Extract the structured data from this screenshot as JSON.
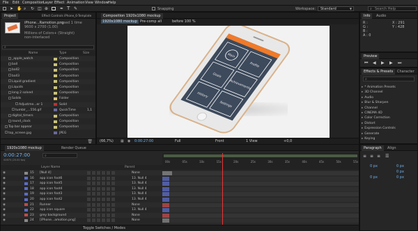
{
  "app": {
    "menu": [
      "File",
      "Edit",
      "Composition",
      "Layer",
      "Effect",
      "Animation",
      "View",
      "Window",
      "Help"
    ],
    "snapping_label": "Snapping",
    "workspace_label": "Workspace:",
    "workspace_value": "Standard",
    "search_placeholder": "Search Help"
  },
  "project": {
    "tab_label": "Project",
    "effect_controls_label": "Effect Controls iPhone_6-Template",
    "file_name": "iPhone...Ramotion.png",
    "file_used": ", used 1 time",
    "file_dims": "9600 x 2700 (1.00)",
    "file_color": "Millions of Colors+ (Straight)",
    "file_interlace": "non-interlaced",
    "col_name": "Name",
    "col_type": "Type",
    "col_size": "Size",
    "items": [
      {
        "name": "_apple_watch",
        "type": "Composition",
        "size": "",
        "color": "#c9c27a",
        "indent": 1
      },
      {
        "name": "ball",
        "type": "Composition",
        "size": "",
        "color": "#c9c27a",
        "indent": 1
      },
      {
        "name": "ball2",
        "type": "Composition",
        "size": "",
        "color": "#c9c27a",
        "indent": 1
      },
      {
        "name": "ball3",
        "type": "Composition",
        "size": "",
        "color": "#c9c27a",
        "indent": 1
      },
      {
        "name": "Liquid gradient",
        "type": "Composition",
        "size": "",
        "color": "#c9c27a",
        "indent": 1
      },
      {
        "name": "Liquids",
        "type": "Composition",
        "size": "",
        "color": "#c9c27a",
        "indent": 1
      },
      {
        "name": "long 2 solved",
        "type": "Composition",
        "size": "",
        "color": "#c9c27a",
        "indent": 1
      },
      {
        "name": "Solids",
        "type": "Folder",
        "size": "",
        "color": "#d8c27a",
        "indent": 1
      },
      {
        "name": "Adjustme...er 1",
        "type": "Solid",
        "size": "",
        "color": "#b33",
        "indent": 3
      },
      {
        "name": "tumblr_...556.gif",
        "type": "QuickTime",
        "size": "1,1",
        "color": "#6a6a9a",
        "indent": 2
      },
      {
        "name": "digital_timers",
        "type": "Composition",
        "size": "",
        "color": "#c9c27a",
        "indent": 1
      },
      {
        "name": "round_clock",
        "type": "Composition",
        "size": "",
        "color": "#c9c27a",
        "indent": 1
      },
      {
        "name": "Top bar appear",
        "type": "Composition",
        "size": "",
        "color": "#c9c27a",
        "indent": 0
      },
      {
        "name": "top_screen.jpg",
        "type": "JPEG",
        "size": "",
        "color": "#6a6a9a",
        "indent": 0
      }
    ]
  },
  "composition": {
    "tab_label": "Composition 1920x1080 mockup",
    "crumbs": [
      "1920x1080 mockup",
      "Pre-comp all",
      "before 100 %"
    ],
    "zoom": "(66,7%)",
    "time": "0:00:27:00",
    "resolution": "Full",
    "camera": "Front",
    "views": "1 View",
    "offset": "+0,0"
  },
  "phone": {
    "tiles": [
      "Main",
      "Profile",
      "Achievements",
      "Goals",
      "Settings",
      "History"
    ]
  },
  "info": {
    "tabs": [
      "Info",
      "Audio"
    ],
    "r": "R :",
    "g": "G :",
    "b": "B :",
    "a": "A : 0",
    "x": "X : 291",
    "y": "Y : 428"
  },
  "preview": {
    "tab_label": "Preview"
  },
  "effects": {
    "tab_label": "Effects & Presets",
    "char_tab": "Character",
    "search_placeholder": "",
    "items": [
      "* Animation Presets",
      "3D Channel",
      "Audio",
      "Blur & Sharpen",
      "Channel",
      "CINEMA 4D",
      "Color Correction",
      "Distort",
      "Expression Controls",
      "Generate",
      "Keying"
    ]
  },
  "paragraph": {
    "tabs": [
      "Paragraph",
      "Align"
    ],
    "fields": [
      "0 px",
      "0 px",
      "0 px",
      "0 px",
      "0 px"
    ]
  },
  "timeline": {
    "tab_label": "1920x1080 mockup",
    "render_queue_label": "Render Queue",
    "timecode": "0:00:27:00",
    "frames": "00675 (25.00 fps)",
    "col_layer": "Layer Name",
    "col_parent": "Parent",
    "ruler": [
      "00s",
      "05s",
      "10s",
      "15s",
      "20s",
      "25s",
      "30s",
      "35s",
      "40s",
      "45s",
      "50s",
      "55s"
    ],
    "toggle_label": "Toggle Switches / Modes",
    "layers": [
      {
        "num": "15",
        "name": "[Null 4]",
        "parent": "None",
        "color": "#8a8a8a"
      },
      {
        "num": "16",
        "name": "app icon foot6",
        "parent": "13. Null 4",
        "color": "#5b6cc9"
      },
      {
        "num": "17",
        "name": "app icon foot5",
        "parent": "13. Null 4",
        "color": "#5b6cc9"
      },
      {
        "num": "18",
        "name": "app icon foot4",
        "parent": "13. Null 4",
        "color": "#5b6cc9"
      },
      {
        "num": "19",
        "name": "app icon foot3",
        "parent": "13. Null 4",
        "color": "#5b6cc9"
      },
      {
        "num": "20",
        "name": "app icon foot2",
        "parent": "13. Null 4",
        "color": "#5b6cc9"
      },
      {
        "num": "21",
        "name": "Runner",
        "parent": "None",
        "color": "#c24a4a"
      },
      {
        "num": "22",
        "name": "app icon square",
        "parent": "13. Null 4",
        "color": "#5b6cc9"
      },
      {
        "num": "23",
        "name": "grey background",
        "parent": "None",
        "color": "#c24a4a"
      },
      {
        "num": "24",
        "name": "[iPhone...amotion.png]",
        "parent": "None",
        "color": "#8a8a8a"
      }
    ]
  }
}
